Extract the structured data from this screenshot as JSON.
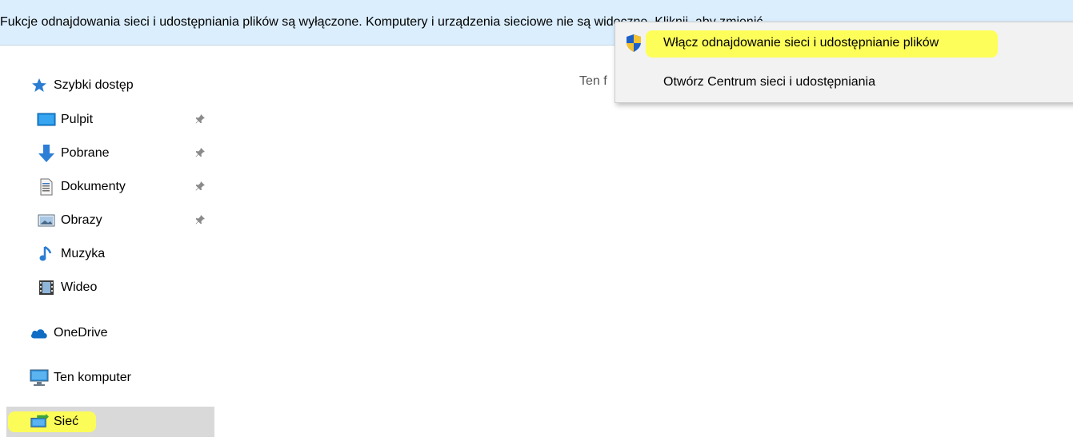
{
  "infobar": {
    "text": "Fukcje odnajdowania sieci i udostępniania plików są wyłączone. Komputery i urządzenia sieciowe nie są widoczne. Kliknij, aby zmienić..."
  },
  "content": {
    "empty_text": "Ten f"
  },
  "context_menu": {
    "items": [
      {
        "label": "Włącz odnajdowanie sieci i udostępnianie plików",
        "icon": "uac-shield-icon"
      },
      {
        "label": "Otwórz Centrum sieci i udostępniania"
      }
    ]
  },
  "nav": {
    "quick_access": {
      "label": "Szybki dostęp",
      "icon": "star-icon"
    },
    "items": [
      {
        "label": "Pulpit",
        "icon": "desktop-icon",
        "pinned": true
      },
      {
        "label": "Pobrane",
        "icon": "download-arrow-icon",
        "pinned": true
      },
      {
        "label": "Dokumenty",
        "icon": "document-icon",
        "pinned": true
      },
      {
        "label": "Obrazy",
        "icon": "pictures-icon",
        "pinned": true
      },
      {
        "label": "Muzyka",
        "icon": "music-note-icon"
      },
      {
        "label": "Wideo",
        "icon": "film-icon"
      }
    ],
    "onedrive": {
      "label": "OneDrive",
      "icon": "cloud-icon"
    },
    "this_pc": {
      "label": "Ten komputer",
      "icon": "computer-icon"
    },
    "network": {
      "label": "Sieć",
      "icon": "network-icon",
      "selected": true
    }
  },
  "colors": {
    "infobar_bg": "#dbeefe",
    "highlight": "#ffff4a",
    "selected_bg": "#d9d9d9",
    "menu_bg": "#f2f2f2"
  }
}
